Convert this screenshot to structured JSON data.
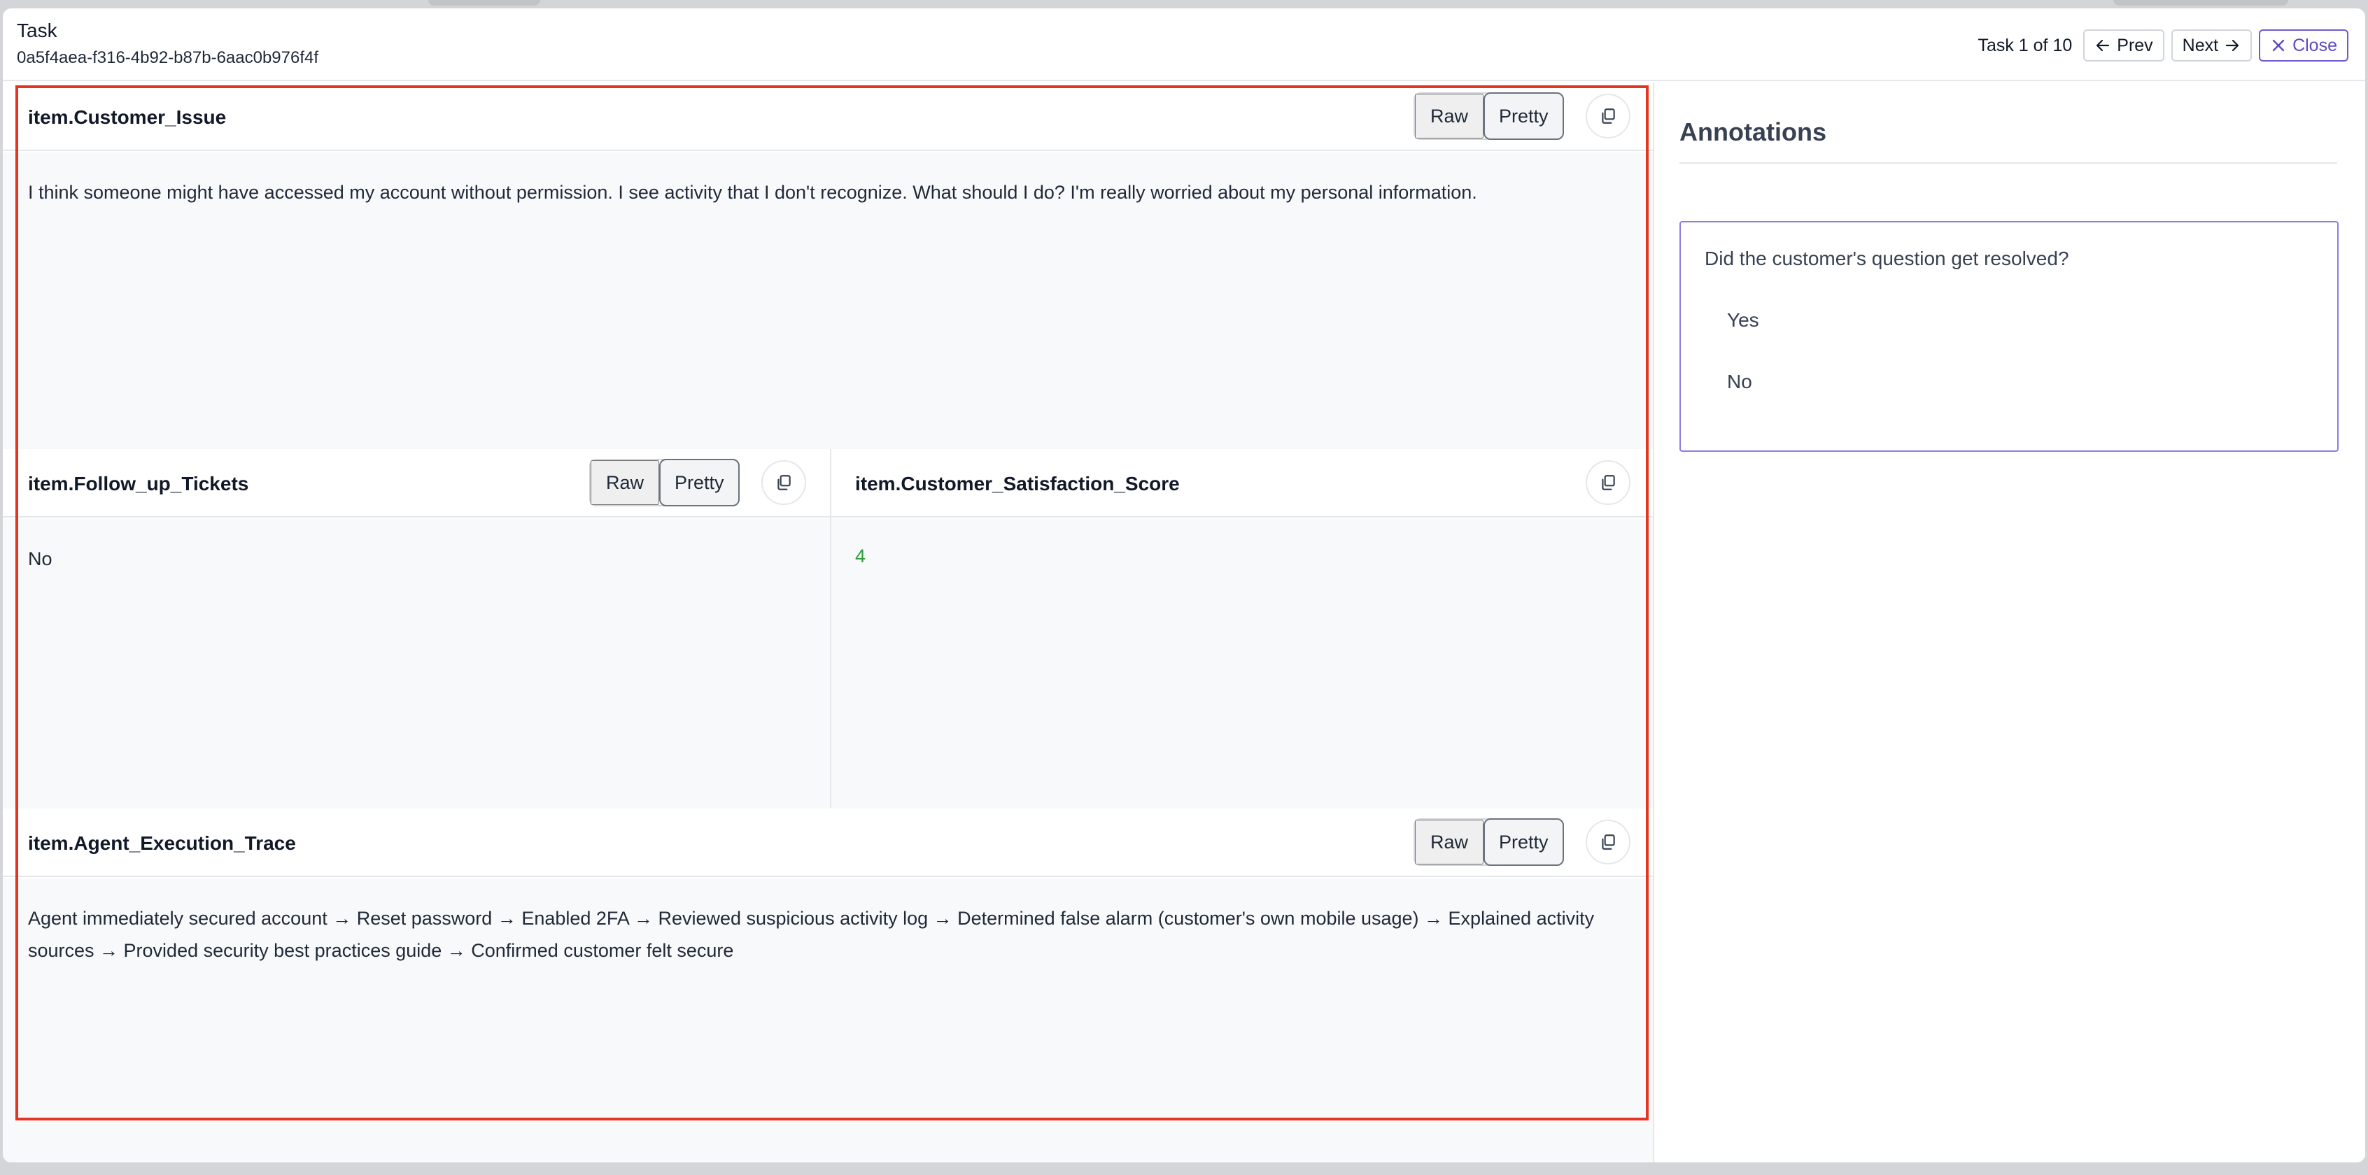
{
  "header": {
    "title": "Task",
    "task_id": "0a5f4aea-f316-4b92-b87b-6aac0b976f4f",
    "counter": "Task 1 of 10",
    "prev_label": "Prev",
    "next_label": "Next",
    "close_label": "Close"
  },
  "panels": {
    "customer_issue": {
      "label": "item.Customer_Issue",
      "raw_label": "Raw",
      "pretty_label": "Pretty",
      "selected_view": "Pretty",
      "text": "I think someone might have accessed my account without permission. I see activity that I don't recognize. What should I do? I'm really worried about my personal information."
    },
    "follow_up_tickets": {
      "label": "item.Follow_up_Tickets",
      "raw_label": "Raw",
      "pretty_label": "Pretty",
      "selected_view": "Pretty",
      "text": "No"
    },
    "satisfaction_score": {
      "label": "item.Customer_Satisfaction_Score",
      "value": "4"
    },
    "execution_trace": {
      "label": "item.Agent_Execution_Trace",
      "raw_label": "Raw",
      "pretty_label": "Pretty",
      "selected_view": "Pretty",
      "text": "Agent immediately secured account → Reset password → Enabled 2FA → Reviewed suspicious activity log → Determined false alarm (customer's own mobile usage) → Explained activity sources → Provided security best practices guide → Confirmed customer felt secure"
    }
  },
  "annotations": {
    "title": "Annotations",
    "question": "Did the customer's question get resolved?",
    "options": [
      "Yes",
      "No"
    ]
  },
  "colors": {
    "highlight_border": "#e5341f",
    "accent": "#5b4bc4",
    "number": "#2e9e3a"
  }
}
